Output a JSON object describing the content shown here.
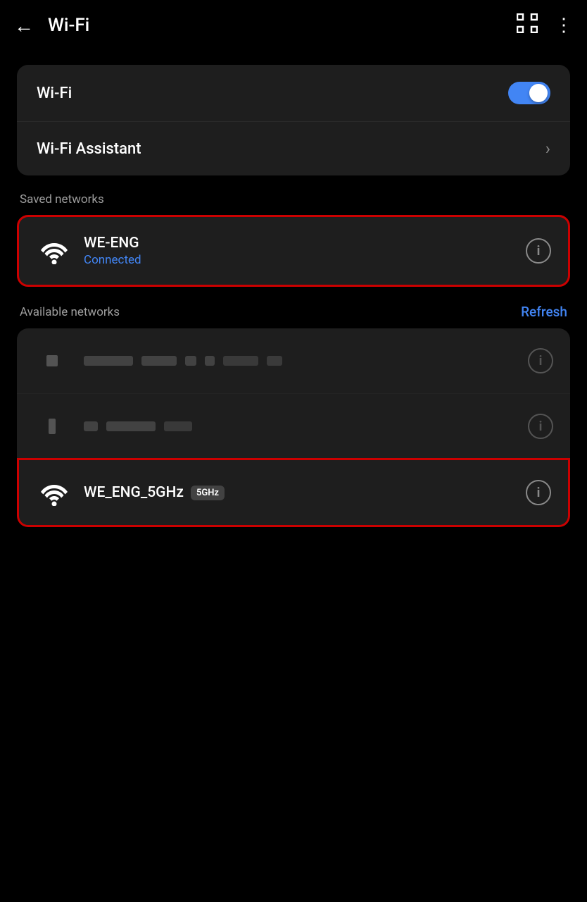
{
  "header": {
    "back_label": "←",
    "title": "Wi-Fi",
    "scan_icon": "⊡",
    "more_icon": "⋮"
  },
  "wifi_card": {
    "wifi_label": "Wi-Fi",
    "wifi_assistant_label": "Wi-Fi Assistant",
    "toggle_on": true
  },
  "saved_networks": {
    "section_label": "Saved networks",
    "connected_network": {
      "name": "WE-ENG",
      "status": "Connected",
      "highlighted": true
    }
  },
  "available_networks": {
    "section_label": "Available networks",
    "refresh_label": "Refresh",
    "networks": [
      {
        "name": "WE_ENG_5GHz",
        "badge": "5GHz",
        "highlighted": true,
        "blurred": false
      }
    ]
  }
}
